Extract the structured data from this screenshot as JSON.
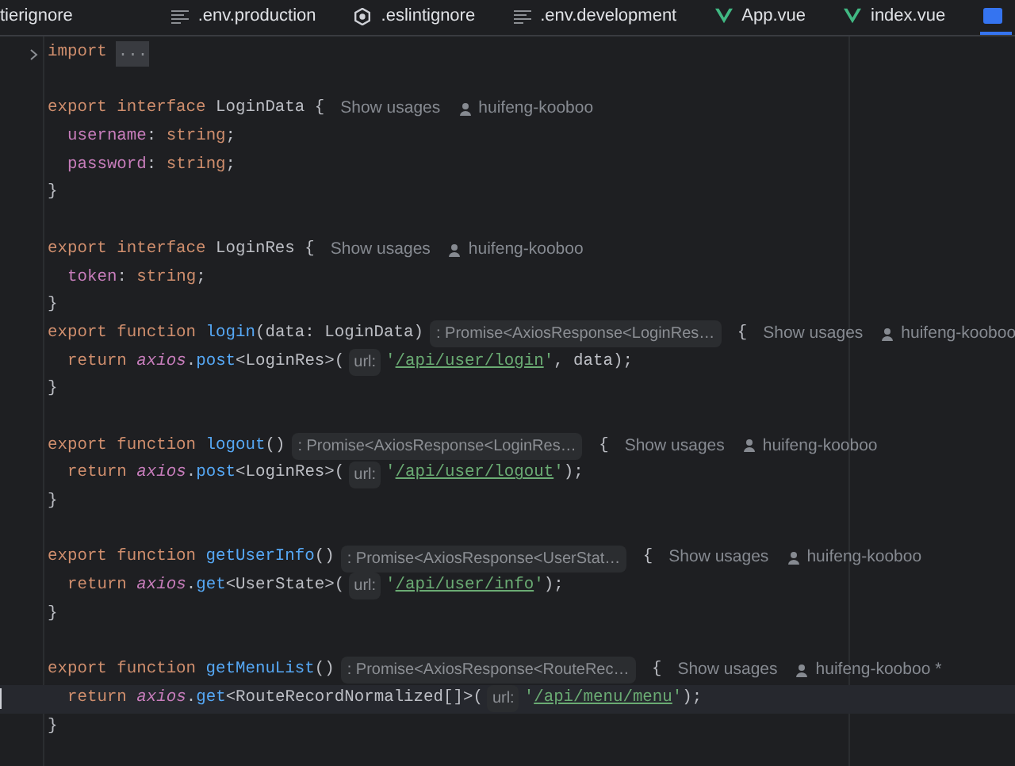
{
  "tabs": [
    {
      "label": "tierignore",
      "kind": "plain",
      "selected": false
    },
    {
      "label": ".env.production",
      "kind": "textfile",
      "selected": false
    },
    {
      "label": ".eslintignore",
      "kind": "settings",
      "selected": false
    },
    {
      "label": ".env.development",
      "kind": "textfile",
      "selected": false
    },
    {
      "label": "App.vue",
      "kind": "vue",
      "selected": false
    },
    {
      "label": "index.vue",
      "kind": "vue",
      "selected": false
    },
    {
      "kind": "typescript",
      "selected": true
    }
  ],
  "lines": [
    {
      "fold": true,
      "segments": [
        {
          "text": "import",
          "kind": "kw"
        },
        {
          "text": "...",
          "kind": "folded"
        }
      ]
    },
    {
      "gap_before": true,
      "segments": [
        {
          "text": "export interface ",
          "kind": "kw"
        },
        {
          "text": "LoginData {",
          "kind": "id"
        },
        {
          "text": "Show usages",
          "kind": "usages"
        },
        {
          "text": "huifeng-kooboo",
          "kind": "author"
        }
      ]
    },
    {
      "indent": true,
      "segments": [
        {
          "text": "username",
          "kind": "prop"
        },
        {
          "text": ": ",
          "kind": "id"
        },
        {
          "text": "string",
          "kind": "kw"
        },
        {
          "text": ";",
          "kind": "id"
        }
      ]
    },
    {
      "indent": true,
      "segments": [
        {
          "text": "password",
          "kind": "prop"
        },
        {
          "text": ": ",
          "kind": "id"
        },
        {
          "text": "string",
          "kind": "kw"
        },
        {
          "text": ";",
          "kind": "id"
        }
      ]
    },
    {
      "segments": [
        {
          "text": "}",
          "kind": "id"
        }
      ]
    },
    {
      "gap_before": true,
      "segments": [
        {
          "text": "export interface ",
          "kind": "kw"
        },
        {
          "text": "LoginRes {",
          "kind": "id"
        },
        {
          "text": "Show usages",
          "kind": "usages"
        },
        {
          "text": "huifeng-kooboo",
          "kind": "author"
        }
      ]
    },
    {
      "indent": true,
      "segments": [
        {
          "text": "token",
          "kind": "prop"
        },
        {
          "text": ": ",
          "kind": "id"
        },
        {
          "text": "string",
          "kind": "kw"
        },
        {
          "text": ";",
          "kind": "id"
        }
      ]
    },
    {
      "segments": [
        {
          "text": "}",
          "kind": "id"
        }
      ]
    },
    {
      "segments": [
        {
          "text": "export function ",
          "kind": "kw"
        },
        {
          "text": "login",
          "kind": "fn"
        },
        {
          "text": "(data: LoginData)",
          "kind": "id"
        },
        {
          "text": ": Promise<AxiosResponse<LoginRes…",
          "kind": "hint"
        },
        {
          "text": " {",
          "kind": "id"
        },
        {
          "text": "Show usages",
          "kind": "usages"
        },
        {
          "text": "huifeng-kooboo",
          "kind": "author"
        }
      ]
    },
    {
      "indent": true,
      "segments": [
        {
          "text": "return ",
          "kind": "kw"
        },
        {
          "text": "axios",
          "kind": "obj"
        },
        {
          "text": ".",
          "kind": "id"
        },
        {
          "text": "post",
          "kind": "fn"
        },
        {
          "text": "<LoginRes>(",
          "kind": "id"
        },
        {
          "text": "url:",
          "kind": "param"
        },
        {
          "text": "'",
          "kind": "str"
        },
        {
          "text": "/api/user/login",
          "kind": "url"
        },
        {
          "text": "'",
          "kind": "str"
        },
        {
          "text": ", data);",
          "kind": "id"
        }
      ]
    },
    {
      "segments": [
        {
          "text": "}",
          "kind": "id"
        }
      ]
    },
    {
      "gap_before": true,
      "segments": [
        {
          "text": "export function ",
          "kind": "kw"
        },
        {
          "text": "logout",
          "kind": "fn"
        },
        {
          "text": "()",
          "kind": "id"
        },
        {
          "text": ": Promise<AxiosResponse<LoginRes…",
          "kind": "hint"
        },
        {
          "text": " {",
          "kind": "id"
        },
        {
          "text": "Show usages",
          "kind": "usages"
        },
        {
          "text": "huifeng-kooboo",
          "kind": "author"
        }
      ]
    },
    {
      "indent": true,
      "segments": [
        {
          "text": "return ",
          "kind": "kw"
        },
        {
          "text": "axios",
          "kind": "obj"
        },
        {
          "text": ".",
          "kind": "id"
        },
        {
          "text": "post",
          "kind": "fn"
        },
        {
          "text": "<LoginRes>(",
          "kind": "id"
        },
        {
          "text": "url:",
          "kind": "param"
        },
        {
          "text": "'",
          "kind": "str"
        },
        {
          "text": "/api/user/logout",
          "kind": "url"
        },
        {
          "text": "'",
          "kind": "str"
        },
        {
          "text": ");",
          "kind": "id"
        }
      ]
    },
    {
      "segments": [
        {
          "text": "}",
          "kind": "id"
        }
      ]
    },
    {
      "gap_before": true,
      "segments": [
        {
          "text": "export function ",
          "kind": "kw"
        },
        {
          "text": "getUserInfo",
          "kind": "fn"
        },
        {
          "text": "()",
          "kind": "id"
        },
        {
          "text": ": Promise<AxiosResponse<UserStat…",
          "kind": "hint"
        },
        {
          "text": " {",
          "kind": "id"
        },
        {
          "text": "Show usages",
          "kind": "usages"
        },
        {
          "text": "huifeng-kooboo",
          "kind": "author"
        }
      ]
    },
    {
      "indent": true,
      "segments": [
        {
          "text": "return ",
          "kind": "kw"
        },
        {
          "text": "axios",
          "kind": "obj"
        },
        {
          "text": ".",
          "kind": "id"
        },
        {
          "text": "get",
          "kind": "fn"
        },
        {
          "text": "<UserState>(",
          "kind": "id"
        },
        {
          "text": "url:",
          "kind": "param"
        },
        {
          "text": "'",
          "kind": "str"
        },
        {
          "text": "/api/user/info",
          "kind": "url"
        },
        {
          "text": "'",
          "kind": "str"
        },
        {
          "text": ");",
          "kind": "id"
        }
      ]
    },
    {
      "segments": [
        {
          "text": "}",
          "kind": "id"
        }
      ]
    },
    {
      "gap_before": true,
      "segments": [
        {
          "text": "export function ",
          "kind": "kw"
        },
        {
          "text": "getMenuList",
          "kind": "fn"
        },
        {
          "text": "()",
          "kind": "id"
        },
        {
          "text": ": Promise<AxiosResponse<RouteRec…",
          "kind": "hint"
        },
        {
          "text": " {",
          "kind": "id"
        },
        {
          "text": "Show usages",
          "kind": "usages"
        },
        {
          "text": "huifeng-kooboo *",
          "kind": "author"
        }
      ]
    },
    {
      "current": true,
      "indent": true,
      "segments": [
        {
          "text": "return ",
          "kind": "kw"
        },
        {
          "text": "axios",
          "kind": "obj"
        },
        {
          "text": ".",
          "kind": "id"
        },
        {
          "text": "get",
          "kind": "fn"
        },
        {
          "text": "<RouteRecordNormalized[]>(",
          "kind": "id"
        },
        {
          "text": "url:",
          "kind": "param"
        },
        {
          "text": "'",
          "kind": "str"
        },
        {
          "text": "/api/menu/menu",
          "kind": "url"
        },
        {
          "text": "'",
          "kind": "str"
        },
        {
          "text": ");",
          "kind": "id"
        }
      ]
    },
    {
      "segments": [
        {
          "text": "}",
          "kind": "id"
        }
      ]
    }
  ]
}
